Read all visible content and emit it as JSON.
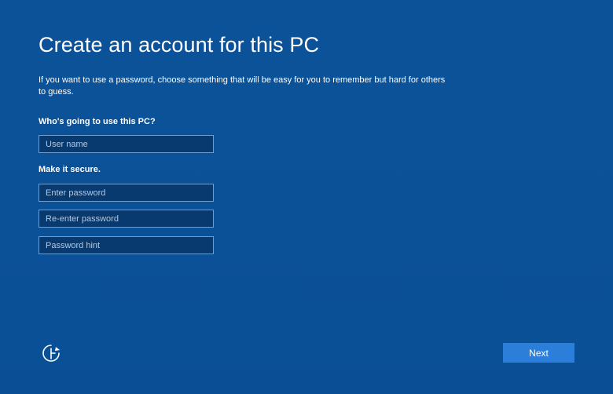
{
  "page": {
    "title": "Create an account for this PC",
    "intro": "If you want to use a password, choose something that will be easy for you to remember but hard for others to guess.",
    "background_color": "#0c5198"
  },
  "account": {
    "who_label": "Who's going to use this PC?",
    "username_placeholder": "User name",
    "username_value": ""
  },
  "security": {
    "secure_label": "Make it secure.",
    "password_placeholder": "Enter password",
    "reenter_placeholder": "Re-enter password",
    "hint_placeholder": "Password hint"
  },
  "footer": {
    "ease_of_access_icon": "ease-of-access-icon",
    "next_label": "Next",
    "next_color": "#2b7fdb"
  }
}
